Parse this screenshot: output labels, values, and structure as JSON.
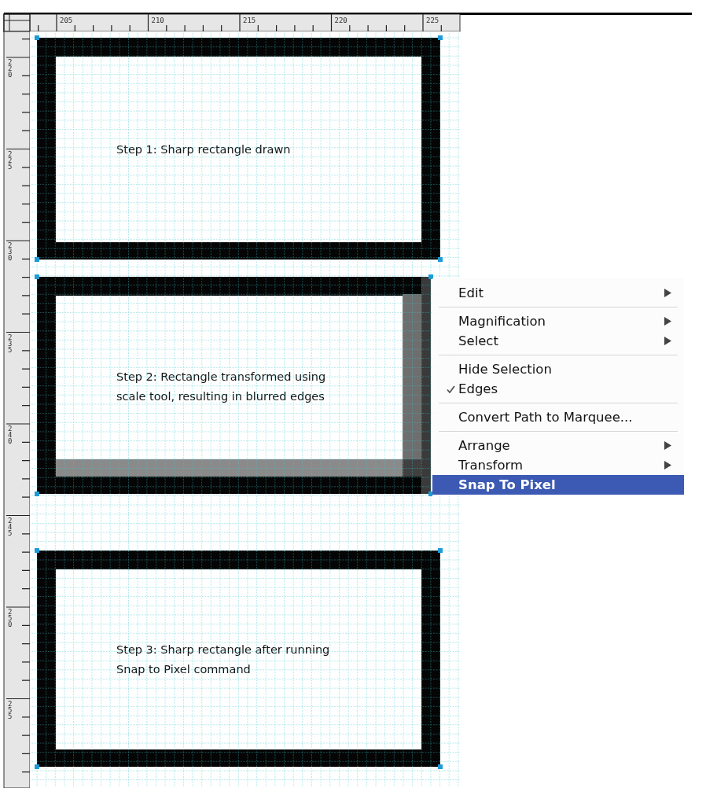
{
  "ruler_horizontal": {
    "labels": [
      "205",
      "210",
      "215",
      "220",
      "225"
    ]
  },
  "ruler_vertical": {
    "labels": [
      "220",
      "225",
      "230",
      "235",
      "240",
      "245",
      "250",
      "255"
    ]
  },
  "rectangles": [
    {
      "kind": "sharp",
      "caption": [
        "Step 1: Sharp rectangle drawn"
      ]
    },
    {
      "kind": "blurred",
      "caption": [
        "Step 2: Rectangle transformed using",
        "scale tool, resulting in blurred edges"
      ]
    },
    {
      "kind": "sharp",
      "caption": [
        "Step 3: Sharp rectangle after running",
        "Snap to Pixel command"
      ]
    }
  ],
  "context_menu": {
    "items": [
      {
        "kind": "item",
        "label": "Edit",
        "submenu": true,
        "checked": false,
        "selected": false
      },
      {
        "kind": "separator"
      },
      {
        "kind": "item",
        "label": "Magnification",
        "submenu": true,
        "checked": false,
        "selected": false
      },
      {
        "kind": "item",
        "label": "Select",
        "submenu": true,
        "checked": false,
        "selected": false
      },
      {
        "kind": "separator"
      },
      {
        "kind": "item",
        "label": "Hide Selection",
        "submenu": false,
        "checked": false,
        "selected": false
      },
      {
        "kind": "item",
        "label": "Edges",
        "submenu": false,
        "checked": true,
        "selected": false
      },
      {
        "kind": "separator"
      },
      {
        "kind": "item",
        "label": "Convert Path to Marquee...",
        "submenu": false,
        "checked": false,
        "selected": false
      },
      {
        "kind": "separator"
      },
      {
        "kind": "item",
        "label": "Arrange",
        "submenu": true,
        "checked": false,
        "selected": false
      },
      {
        "kind": "item",
        "label": "Transform",
        "submenu": true,
        "checked": false,
        "selected": false
      },
      {
        "kind": "item",
        "label": "Snap To Pixel",
        "submenu": false,
        "checked": false,
        "selected": true
      }
    ]
  }
}
